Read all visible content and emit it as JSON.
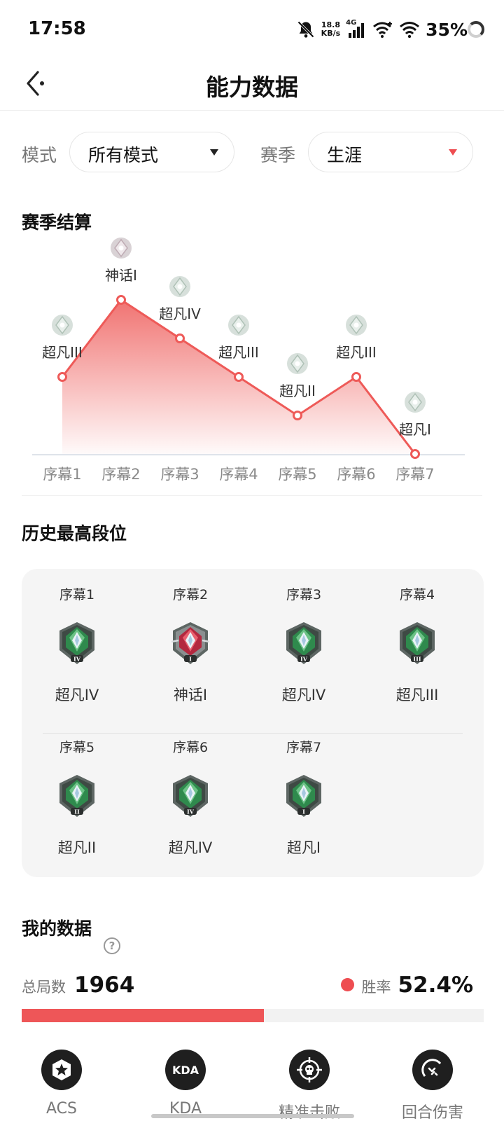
{
  "status_bar": {
    "time": "17:58",
    "speed_value": "18.8",
    "speed_unit": "KB/s",
    "network": "4G",
    "battery": "35%"
  },
  "header": {
    "title": "能力数据"
  },
  "filters": {
    "mode_label": "模式",
    "mode_value": "所有模式",
    "season_label": "赛季",
    "season_value": "生涯"
  },
  "season_settlement": {
    "title": "赛季结算"
  },
  "chart_data": {
    "type": "line",
    "title": "赛季结算",
    "categories": [
      "序幕1",
      "序幕2",
      "序幕3",
      "序幕4",
      "序幕5",
      "序幕6",
      "序幕7"
    ],
    "rank_labels": [
      "超凡III",
      "神话I",
      "超凡IV",
      "超凡III",
      "超凡II",
      "超凡III",
      "超凡I"
    ],
    "values": [
      3,
      5,
      4,
      3,
      2,
      3,
      1
    ],
    "ylim": [
      1,
      5
    ],
    "grid": true,
    "area_fill": true,
    "line_color": "#ee5a58"
  },
  "history": {
    "title": "历史最高段位",
    "items": [
      {
        "season": "序幕1",
        "rank": "超凡IV",
        "tier": "IV",
        "type": "green"
      },
      {
        "season": "序幕2",
        "rank": "神话I",
        "tier": "I",
        "type": "red"
      },
      {
        "season": "序幕3",
        "rank": "超凡IV",
        "tier": "IV",
        "type": "green"
      },
      {
        "season": "序幕4",
        "rank": "超凡III",
        "tier": "III",
        "type": "green"
      },
      {
        "season": "序幕5",
        "rank": "超凡II",
        "tier": "II",
        "type": "green"
      },
      {
        "season": "序幕6",
        "rank": "超凡IV",
        "tier": "IV",
        "type": "green"
      },
      {
        "season": "序幕7",
        "rank": "超凡I",
        "tier": "I",
        "type": "green"
      }
    ]
  },
  "my_data": {
    "title": "我的数据",
    "help": "?",
    "total_label": "总局数",
    "total_value": "1964",
    "winrate_label": "胜率",
    "winrate_value": "52.4%",
    "winrate_fraction": 0.524
  },
  "tabs": [
    {
      "label": "ACS",
      "icon": "star-badge-icon"
    },
    {
      "label": "KDA",
      "icon": "kda-icon",
      "icon_text": "KDA"
    },
    {
      "label": "精准击败",
      "icon": "crosshair-skull-icon"
    },
    {
      "label": "回合伤害",
      "icon": "damage-icon"
    }
  ],
  "colors": {
    "accent": "#ee4d51",
    "green_badge": "#3f9a5a",
    "red_badge": "#c8344a"
  }
}
